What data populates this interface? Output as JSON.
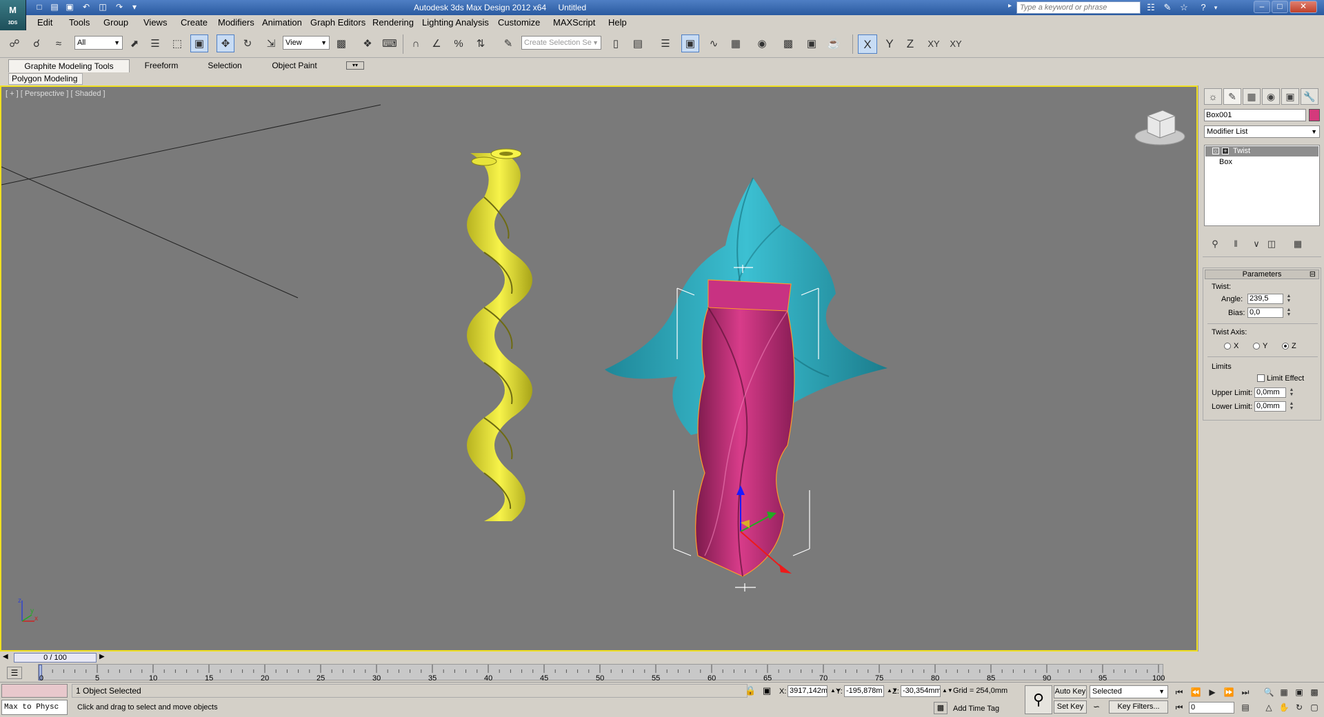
{
  "window": {
    "app_title": "Autodesk 3ds Max Design 2012 x64",
    "doc_title": "Untitled",
    "search_placeholder": "Type a keyword or phrase",
    "logo_text": "M",
    "logo_sub": "3DS"
  },
  "menu": [
    "Edit",
    "Tools",
    "Group",
    "Views",
    "Create",
    "Modifiers",
    "Animation",
    "Graph Editors",
    "Rendering",
    "Lighting Analysis",
    "Customize",
    "MAXScript",
    "Help"
  ],
  "toolbar": {
    "filter_value": "All",
    "refcoord_value": "View",
    "selection_set_placeholder": "Create Selection Se",
    "axis_x": "X",
    "axis_y": "Y",
    "axis_z": "Z",
    "axis_xy": "XY",
    "axis_xy2": "XY"
  },
  "ribbon": {
    "tabs": [
      "Graphite Modeling Tools",
      "Freeform",
      "Selection",
      "Object Paint"
    ],
    "panel": "Polygon Modeling"
  },
  "viewport": {
    "label": "[ + ] [ Perspective ] [ Shaded ]",
    "axis_z": "z",
    "axis_y": "y",
    "axis_x": "x"
  },
  "command_panel": {
    "object_name": "Box001",
    "object_color": "#d43a7c",
    "modifier_list": "Modifier List",
    "stack": [
      "Twist",
      "Box"
    ],
    "rollout_title": "Parameters",
    "twist_group": "Twist:",
    "angle_label": "Angle:",
    "angle_value": "239,5",
    "bias_label": "Bias:",
    "bias_value": "0,0",
    "axis_group": "Twist Axis:",
    "axis_x": "X",
    "axis_y": "Y",
    "axis_z": "Z",
    "selected_axis": "Z",
    "limits_group": "Limits",
    "limit_effect": "Limit Effect",
    "upper_label": "Upper Limit:",
    "upper_value": "0,0mm",
    "lower_label": "Lower Limit:",
    "lower_value": "0,0mm"
  },
  "timeline": {
    "slider": "0 / 100",
    "ticks": [
      "0",
      "5",
      "10",
      "15",
      "20",
      "25",
      "30",
      "35",
      "40",
      "45",
      "50",
      "55",
      "60",
      "65",
      "70",
      "75",
      "80",
      "85",
      "90",
      "95",
      "100"
    ]
  },
  "status": {
    "maxscript": "Max to Physc",
    "selection": "1 Object Selected",
    "prompt": "Click and drag to select and move objects",
    "x_label": "X:",
    "x_value": "3917,142m",
    "y_label": "Y:",
    "y_value": "-195,878m",
    "z_label": "Z:",
    "z_value": "-30,354mm",
    "grid": "Grid = 254,0mm",
    "add_time_tag": "Add Time Tag",
    "auto_key": "Auto Key",
    "set_key": "Set Key",
    "selected_dd": "Selected",
    "key_filters": "Key Filters...",
    "frame": "0"
  },
  "colors": {
    "viewport_border": "#f0e020",
    "twisted_yellow": "#f2ee30",
    "twisted_cyan": "#2aa6b8",
    "twisted_magenta": "#c02e78"
  }
}
